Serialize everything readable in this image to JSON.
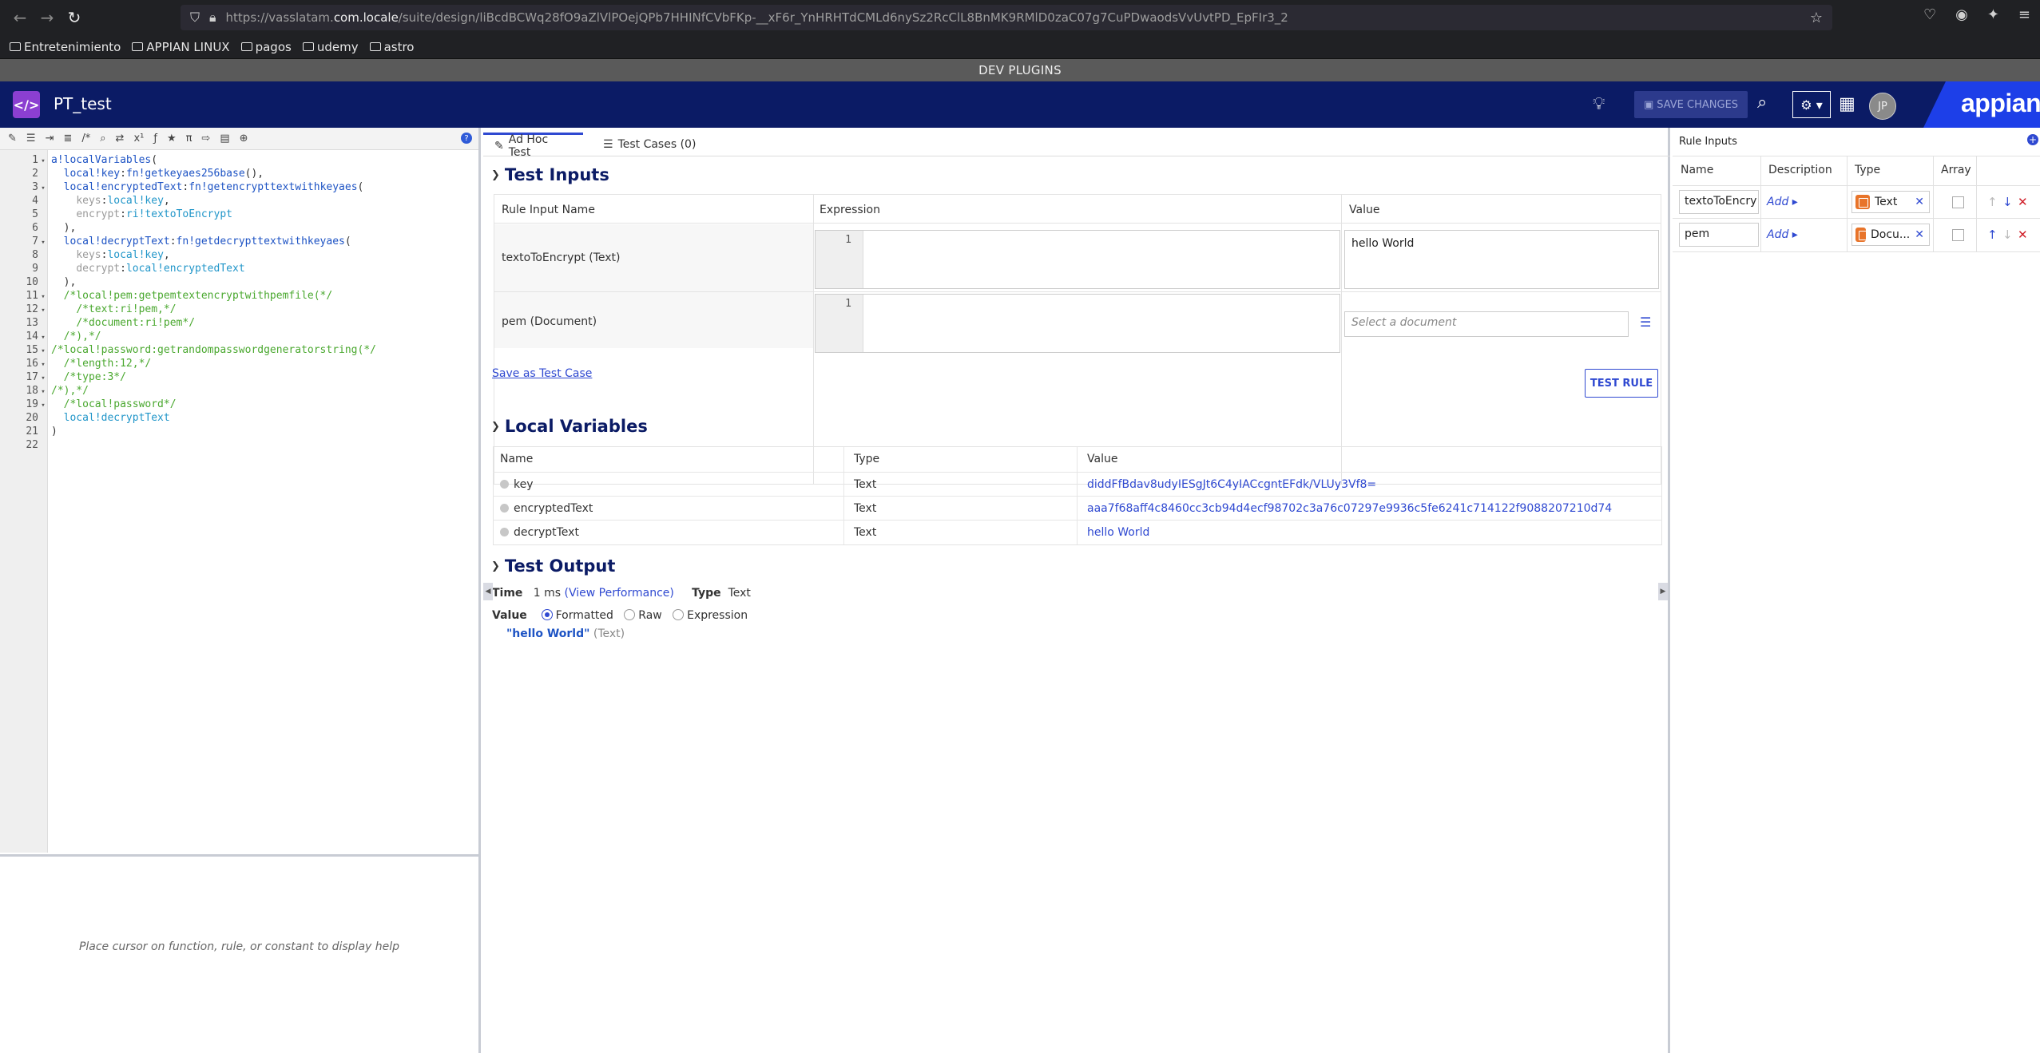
{
  "browser": {
    "url_prefix": "https://vasslatam.",
    "url_domain": "com.locale",
    "url_suffix": "/suite/design/liBcdBCWq28fO9aZlVlPOejQPb7HHINfCVbFKp-__xF6r_YnHRHTdCMLd6nySz2RcClL8BnMK9RMlD0zaC07g7CuPDwaodsVvUvtPD_EpFIr3_2",
    "bookmarks": [
      "Entretenimiento",
      "APPIAN LINUX",
      "pagos",
      "udemy",
      "astro"
    ]
  },
  "dev_bar": "DEV PLUGINS",
  "header": {
    "rule_name": "PT_test",
    "save_label": "SAVE CHANGES",
    "avatar_initials": "JP",
    "logo": "appian"
  },
  "editor": {
    "lines": [
      {
        "n": "1",
        "fold": true,
        "html": "<span class='c-kw'>a!localVariables</span><span class='c-pl'>(</span>"
      },
      {
        "n": "2",
        "fold": false,
        "html": "  <span class='c-kw'>local!key</span><span class='c-pl'>:</span><span class='c-kw'>fn!getkeyaes256base</span><span class='c-pl'>(),</span>"
      },
      {
        "n": "3",
        "fold": true,
        "html": "  <span class='c-kw'>local!encryptedText</span><span class='c-pl'>:</span><span class='c-kw'>fn!getencrypttextwithkeyaes</span><span class='c-pl'>(</span>"
      },
      {
        "n": "4",
        "fold": false,
        "html": "    <span class='c-gr'>keys</span><span class='c-pl'>:</span><span class='c-fn'>local!key</span><span class='c-pl'>,</span>"
      },
      {
        "n": "5",
        "fold": false,
        "html": "    <span class='c-gr'>encrypt</span><span class='c-pl'>:</span><span class='c-fn'>ri!textoToEncrypt</span>"
      },
      {
        "n": "6",
        "fold": false,
        "html": "  <span class='c-pl'>),</span>"
      },
      {
        "n": "7",
        "fold": true,
        "html": "  <span class='c-kw'>local!decryptText</span><span class='c-pl'>:</span><span class='c-kw'>fn!getdecrypttextwithkeyaes</span><span class='c-pl'>(</span>"
      },
      {
        "n": "8",
        "fold": false,
        "html": "    <span class='c-gr'>keys</span><span class='c-pl'>:</span><span class='c-fn'>local!key</span><span class='c-pl'>,</span>"
      },
      {
        "n": "9",
        "fold": false,
        "html": "    <span class='c-gr'>decrypt</span><span class='c-pl'>:</span><span class='c-fn'>local!encryptedText</span>"
      },
      {
        "n": "10",
        "fold": false,
        "html": "  <span class='c-pl'>),</span>"
      },
      {
        "n": "11",
        "fold": true,
        "html": "  <span class='c-cm'>/*local!pem:getpemtextencryptwithpemfile(*/</span>"
      },
      {
        "n": "12",
        "fold": true,
        "html": "    <span class='c-cm'>/*text:ri!pem,*/</span>"
      },
      {
        "n": "13",
        "fold": false,
        "html": "    <span class='c-cm'>/*document:ri!pem*/</span>"
      },
      {
        "n": "14",
        "fold": true,
        "html": "  <span class='c-cm'>/*),*/</span>"
      },
      {
        "n": "15",
        "fold": true,
        "html": "<span class='c-cm'>/*local!password:getrandompasswordgeneratorstring(*/</span>"
      },
      {
        "n": "16",
        "fold": true,
        "html": "  <span class='c-cm'>/*length:12,*/</span>"
      },
      {
        "n": "17",
        "fold": true,
        "html": "  <span class='c-cm'>/*type:3*/</span>"
      },
      {
        "n": "18",
        "fold": true,
        "html": "<span class='c-cm'>/*),*/</span>"
      },
      {
        "n": "19",
        "fold": true,
        "html": "  <span class='c-cm'>/*local!password*/</span>"
      },
      {
        "n": "20",
        "fold": false,
        "html": "  <span class='c-fn'>local!decryptText</span>"
      },
      {
        "n": "21",
        "fold": false,
        "html": "<span class='c-pl'>)</span>"
      },
      {
        "n": "22",
        "fold": false,
        "html": ""
      }
    ],
    "help_text": "Place cursor on function, rule, or constant to display help"
  },
  "tabs": {
    "adhoc": "Ad Hoc Test",
    "cases": "Test Cases (0)"
  },
  "test_inputs": {
    "title": "Test Inputs",
    "col_name": "Rule Input Name",
    "col_expr": "Expression",
    "col_value": "Value",
    "rows": [
      {
        "name": "textoToEncrypt (Text)",
        "line": "1",
        "value": "hello World"
      },
      {
        "name": "pem (Document)",
        "line": "1",
        "placeholder": "Select a document"
      }
    ],
    "save_link": "Save as Test Case",
    "test_button": "TEST RULE"
  },
  "local_variables": {
    "title": "Local Variables",
    "col_name": "Name",
    "col_type": "Type",
    "col_value": "Value",
    "rows": [
      {
        "name": "key",
        "type": "Text",
        "value": "diddFfBdav8udyIESgJt6C4yIACcgntEFdk/VLUy3Vf8="
      },
      {
        "name": "encryptedText",
        "type": "Text",
        "value": "aaa7f68aff4c8460cc3cb94d4ecf98702c3a76c07297e9936c5fe6241c714122f9088207210d74"
      },
      {
        "name": "decryptText",
        "type": "Text",
        "value": "hello World"
      }
    ]
  },
  "test_output": {
    "title": "Test Output",
    "time_label": "Time",
    "time_value": "1 ms",
    "perf_link": "(View Performance)",
    "type_label": "Type",
    "type_value": "Text",
    "value_label": "Value",
    "modes": [
      "Formatted",
      "Raw",
      "Expression"
    ],
    "selected_mode": "Formatted",
    "result": "\"hello World\"",
    "result_type": "(Text)"
  },
  "rule_inputs": {
    "title": "Rule Inputs",
    "col_name": "Name",
    "col_desc": "Description",
    "col_type": "Type",
    "col_array": "Array",
    "rows": [
      {
        "name": "textoToEncry",
        "desc": "Add",
        "type": "Text"
      },
      {
        "name": "pem",
        "desc": "Add",
        "type": "Docu..."
      }
    ]
  },
  "colors": {
    "header_bg": "#0b1b65",
    "accent": "#2f49d1",
    "rule_icon": "#8b3fd1",
    "type_icon": "#e8742a"
  }
}
